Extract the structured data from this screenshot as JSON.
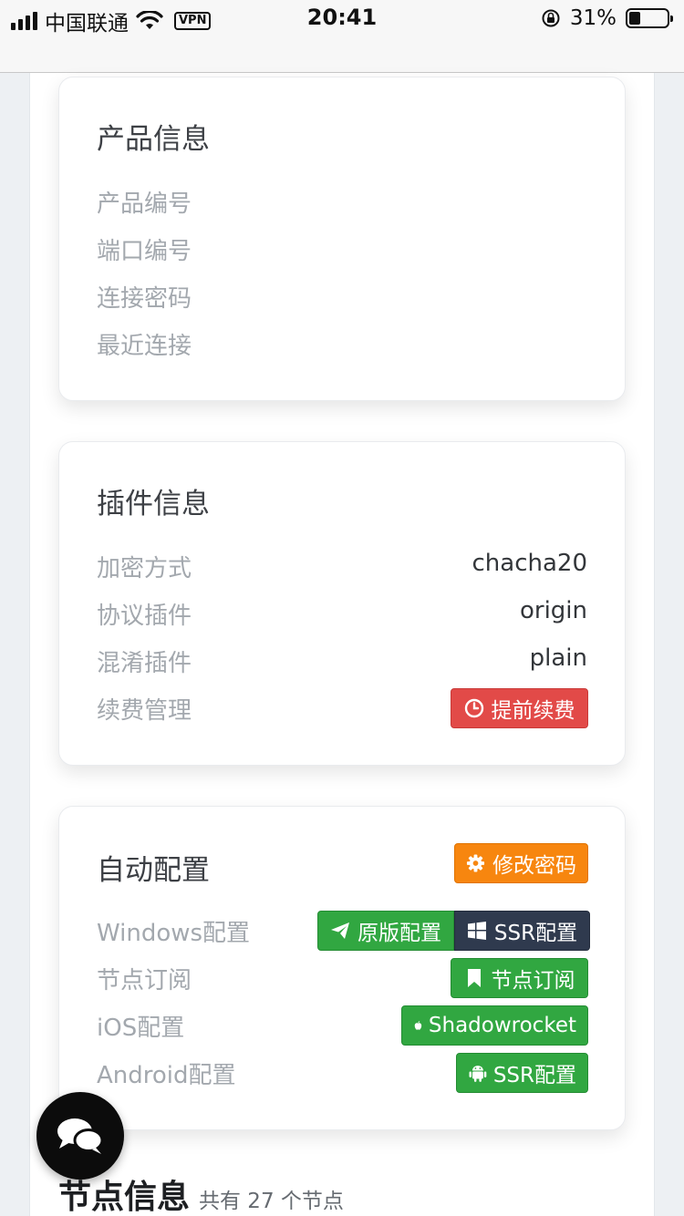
{
  "status_bar": {
    "carrier": "中国联通",
    "vpn": "VPN",
    "time": "20:41",
    "battery_percent": "31%",
    "battery_level": 0.31
  },
  "product_card": {
    "title": "产品信息",
    "rows": [
      {
        "label": "产品编号"
      },
      {
        "label": "端口编号"
      },
      {
        "label": "连接密码"
      },
      {
        "label": "最近连接"
      }
    ]
  },
  "plugin_card": {
    "title": "插件信息",
    "rows": [
      {
        "label": "加密方式",
        "value": "chacha20"
      },
      {
        "label": "协议插件",
        "value": "origin"
      },
      {
        "label": "混淆插件",
        "value": "plain"
      },
      {
        "label": "续费管理"
      }
    ],
    "renew_button": "提前续费"
  },
  "config_card": {
    "title": "自动配置",
    "change_password_button": "修改密码",
    "rows": [
      {
        "label": "Windows配置"
      },
      {
        "label": "节点订阅"
      },
      {
        "label": "iOS配置"
      },
      {
        "label": "Android配置"
      }
    ],
    "windows_original_button": "原版配置",
    "windows_ssr_button": "SSR配置",
    "subscribe_button": "节点订阅",
    "ios_button": "Shadowrocket",
    "android_button": "SSR配置"
  },
  "nodes": {
    "title": "节点信息",
    "subtitle": "共有 27 个节点"
  },
  "colors": {
    "red": "#e24a48",
    "orange": "#f7860f",
    "green": "#31a741",
    "dark": "#2f3a4e"
  }
}
